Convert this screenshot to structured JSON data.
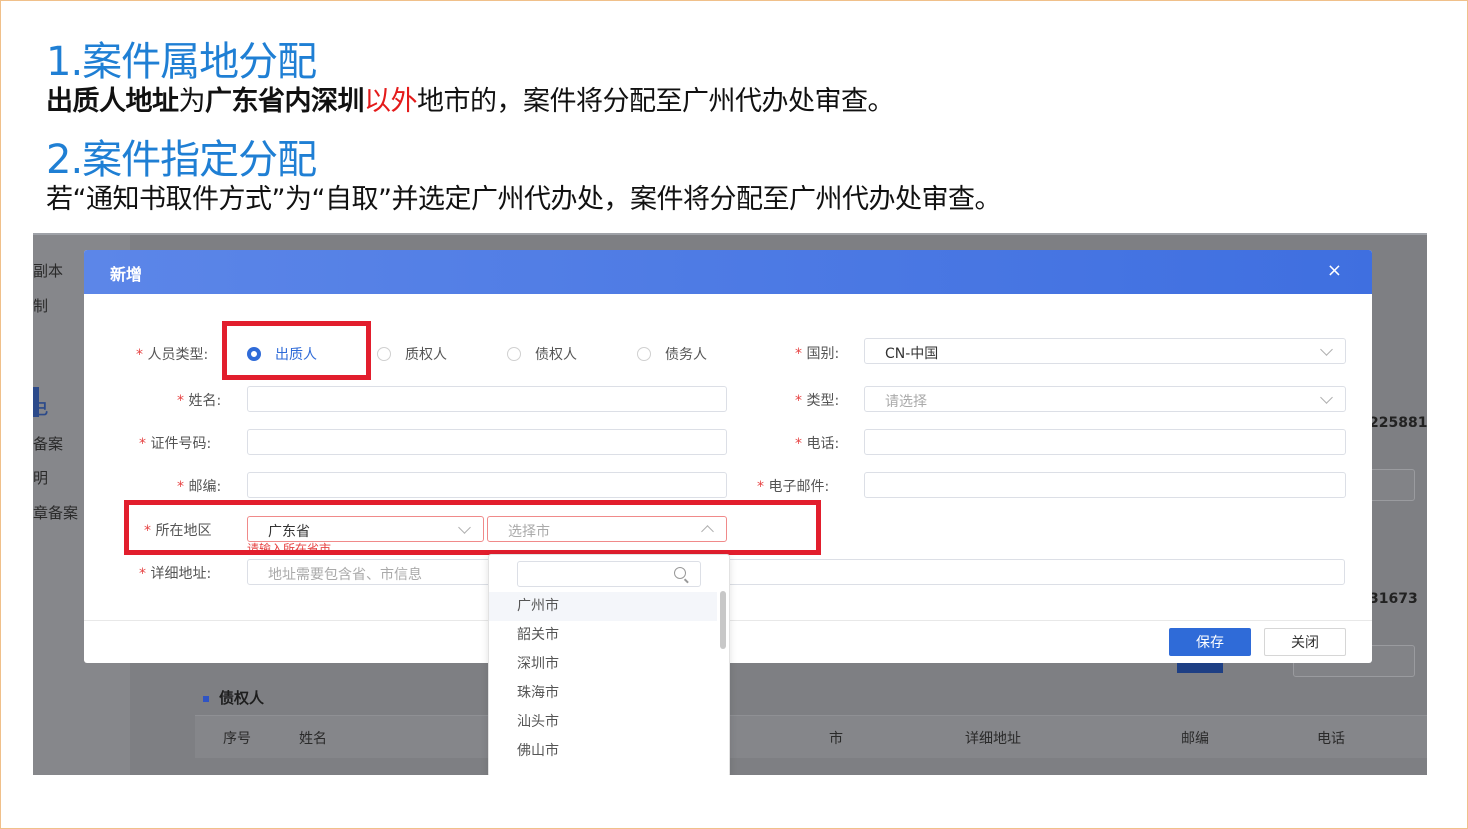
{
  "slide": {
    "heading1": "1.案件属地分配",
    "line1": {
      "b1": "出质人地址",
      "t1": "为",
      "b2": "广东省内深圳",
      "red": "以外",
      "t2": "地市的，案件将分配至广州代办处审查。"
    },
    "heading2": "2.案件指定分配",
    "line2": "若“通知书取件方式”为“自取”并选定广州代办处，案件将分配至广州代办处审查。"
  },
  "background": {
    "left_nav": [
      "副本",
      "制",
      "己",
      "备案",
      "明",
      "章备案"
    ],
    "right_values": [
      "225881",
      "31673"
    ],
    "section_title": "债权人",
    "table_headers": [
      "序号",
      "姓名",
      "市",
      "详细地址",
      "邮编",
      "电话"
    ]
  },
  "modal": {
    "title": "新增",
    "close": "×",
    "fields": {
      "person_type_label": "人员类型:",
      "person_types": [
        "出质人",
        "质权人",
        "债权人",
        "债务人"
      ],
      "selected_person_type": "出质人",
      "name_label": "姓名:",
      "id_label": "证件号码:",
      "zip_label": "邮编:",
      "region_label": "所在地区",
      "province_value": "广东省",
      "city_placeholder": "选择市",
      "region_error": "请输入所在省市",
      "address_label": "详细地址:",
      "address_placeholder": "地址需要包含省、市信息",
      "country_label": "国别:",
      "country_value": "CN-中国",
      "type_label": "类型:",
      "type_placeholder": "请选择",
      "phone_label": "电话:",
      "email_label": "电子邮件:"
    },
    "buttons": {
      "save": "保存",
      "close": "关闭"
    },
    "city_dropdown": [
      "广州市",
      "韶关市",
      "深圳市",
      "珠海市",
      "汕头市",
      "佛山市"
    ]
  },
  "colors": {
    "highlight_red": "#e21e2d",
    "primary_blue": "#2f6bd8",
    "heading_blue": "#1f7fd4"
  }
}
